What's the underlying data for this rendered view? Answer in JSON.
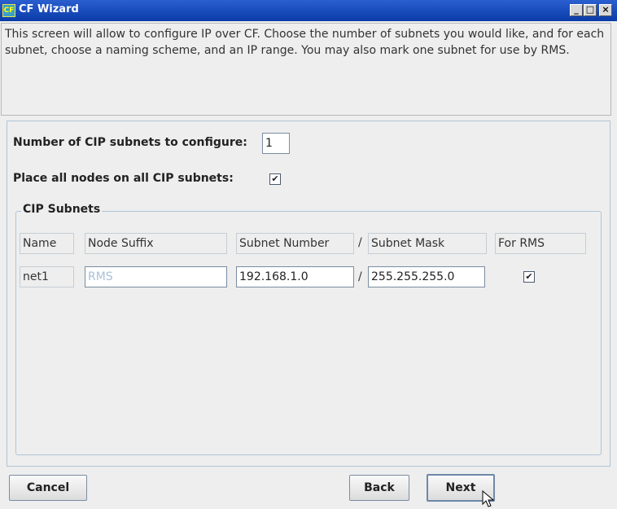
{
  "window": {
    "title": "CF Wizard",
    "app_icon_glyph": "CF",
    "minimize_glyph": "_",
    "maximize_glyph": "□",
    "close_glyph": "×"
  },
  "intro": {
    "text": "This screen will allow to configure IP over CF.  Choose the number of subnets you would like, and for each subnet, choose a naming scheme, and an IP range.  You may also mark one subnet for use by RMS."
  },
  "config": {
    "num_subnets_label": "Number of CIP subnets to configure:",
    "num_subnets_value": "1",
    "all_nodes_label": "Place all nodes on all CIP subnets:",
    "all_nodes_checked": true,
    "check_glyph": "✔"
  },
  "subnets": {
    "legend": "CIP Subnets",
    "headers": {
      "name": "Name",
      "node_suffix": "Node Suffix",
      "subnet_number": "Subnet Number",
      "slash": "/",
      "subnet_mask": "Subnet Mask",
      "for_rms": "For RMS"
    },
    "rows": [
      {
        "name": "net1",
        "node_suffix_placeholder": "RMS",
        "subnet_number": "192.168.1.0",
        "slash": "/",
        "subnet_mask": "255.255.255.0",
        "for_rms": true
      }
    ]
  },
  "buttons": {
    "cancel": "Cancel",
    "back": "Back",
    "next": "Next"
  },
  "colors": {
    "titlebar": "#0a3ba8",
    "background": "#eeeeee",
    "placeholder": "#a8c0d8"
  }
}
